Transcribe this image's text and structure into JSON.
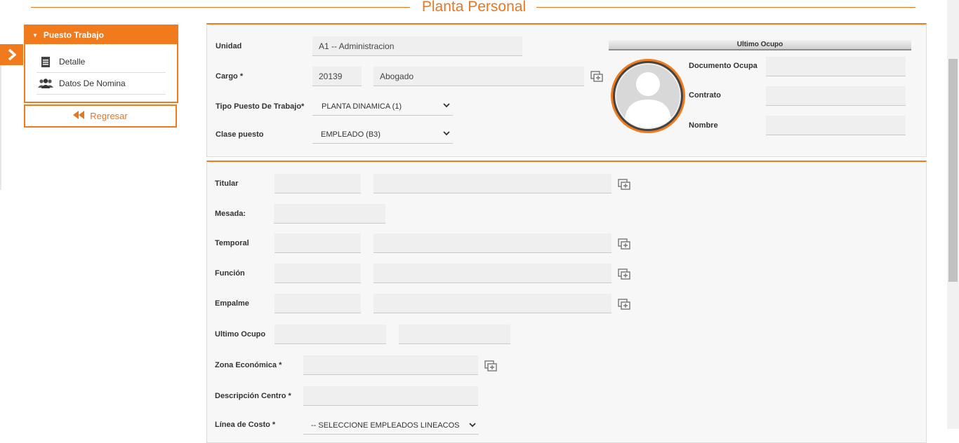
{
  "page": {
    "title": "Planta Personal"
  },
  "sidebar": {
    "toggle_icon": "chevron-right-icon",
    "header": "Puesto Trabajo",
    "items": [
      {
        "label": "Detalle",
        "icon": "document-icon"
      },
      {
        "label": "Datos De Nomina",
        "icon": "users-icon"
      }
    ],
    "back_label": "Regresar"
  },
  "form_top": {
    "unidad": {
      "label": "Unidad",
      "value": "A1           -- Administracion"
    },
    "cargo": {
      "label": "Cargo *",
      "code": "20139",
      "name": "Abogado"
    },
    "tipo_puesto": {
      "label": "Tipo Puesto De Trabajo*",
      "value": "PLANTA DINAMICA (1)"
    },
    "clase_puesto": {
      "label": "Clase puesto",
      "value": "EMPLEADO (B3)"
    }
  },
  "ultimo_ocupo": {
    "header": "Ultimo Ocupo",
    "documento_label": "Documento Ocupa",
    "documento_value": "",
    "contrato_label": "Contrato",
    "contrato_value": "",
    "nombre_label": "Nombre",
    "nombre_value": ""
  },
  "form_bottom": {
    "titular": {
      "label": "Titular"
    },
    "mesada": {
      "label": "Mesada:"
    },
    "temporal": {
      "label": "Temporal"
    },
    "funcion": {
      "label": "Función"
    },
    "empalme": {
      "label": "Empalme"
    },
    "ultimo_ocupo": {
      "label": "Ultimo Ocupo"
    },
    "zona_economica": {
      "label": "Zona Económica *"
    },
    "descripcion_centro": {
      "label": "Descripción Centro *"
    },
    "linea_costo": {
      "label": "Línea de Costo *",
      "value": "-- SELECCIONE EMPLEADOS  LINEACOS"
    }
  },
  "colors": {
    "accent": "#f07a1c",
    "title": "#e87722",
    "panel_bg": "#f7f7f7",
    "field_bg": "#efefef"
  }
}
